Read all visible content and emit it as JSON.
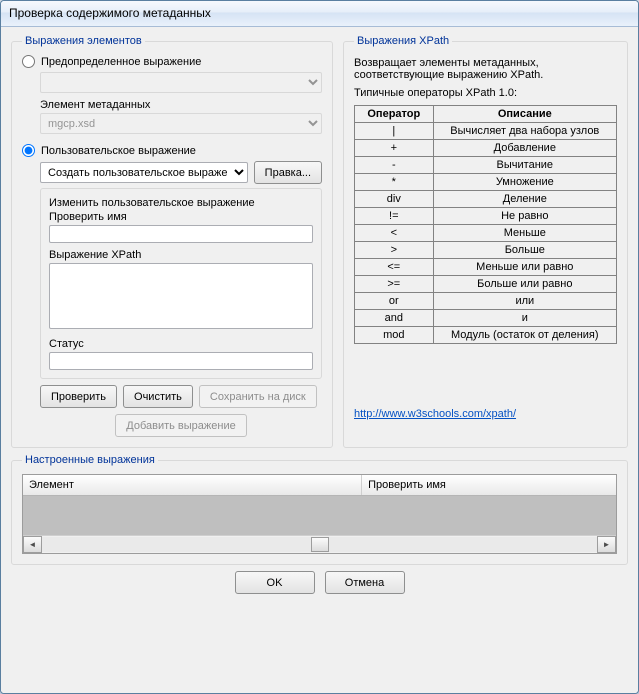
{
  "window": {
    "title": "Проверка содержимого метаданных"
  },
  "left": {
    "legend": "Выражения элементов",
    "predef_label": "Предопределенное выражение",
    "meta_elem_label": "Элемент метаданных",
    "meta_elem_value": "mgcp.xsd",
    "custom_label": "Пользовательское выражение",
    "custom_select": "Создать пользовательское выражен",
    "edit_btn": "Правка...",
    "editbox_legend": "Изменить пользовательское выражение",
    "check_name_label": "Проверить имя",
    "xpath_label": "Выражение XPath",
    "status_label": "Статус",
    "verify_btn": "Проверить",
    "clear_btn": "Очистить",
    "save_btn": "Сохранить на диск",
    "add_btn": "Добавить выражение"
  },
  "right": {
    "legend": "Выражения XPath",
    "desc": "Возвращает элементы метаданных, соответствующие выражению XPath.",
    "ops_caption": "Типичные операторы XPath 1.0:",
    "th_op": "Оператор",
    "th_desc": "Описание",
    "rows": [
      {
        "op": "|",
        "desc": "Вычисляет два набора узлов"
      },
      {
        "op": "+",
        "desc": "Добавление"
      },
      {
        "op": "-",
        "desc": "Вычитание"
      },
      {
        "op": "*",
        "desc": "Умножение"
      },
      {
        "op": "div",
        "desc": "Деление"
      },
      {
        "op": "!=",
        "desc": "Не равно"
      },
      {
        "op": "<",
        "desc": "Меньше"
      },
      {
        "op": ">",
        "desc": "Больше"
      },
      {
        "op": "<=",
        "desc": "Меньше или равно"
      },
      {
        "op": ">=",
        "desc": "Больше или равно"
      },
      {
        "op": "or",
        "desc": "или"
      },
      {
        "op": "and",
        "desc": "и"
      },
      {
        "op": "mod",
        "desc": "Модуль (остаток от деления)"
      }
    ],
    "link": "http://www.w3schools.com/xpath/"
  },
  "configured": {
    "legend": "Настроенные выражения",
    "col_elem": "Элемент",
    "col_name": "Проверить имя"
  },
  "footer": {
    "ok": "OK",
    "cancel": "Отмена"
  }
}
